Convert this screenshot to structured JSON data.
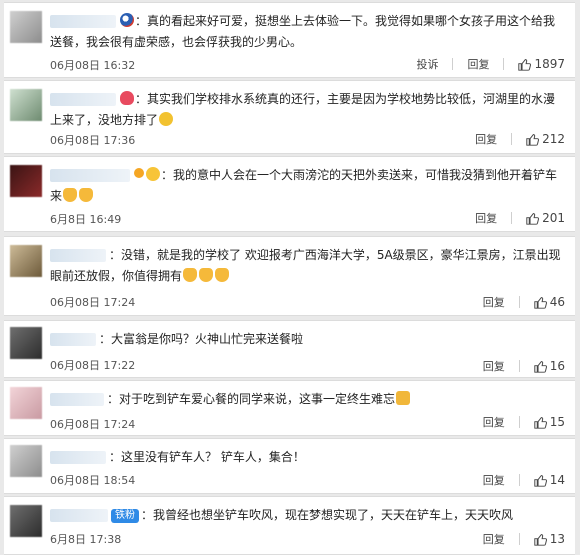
{
  "comments": [
    {
      "text": "真的看起来好可爱，挺想坐上去体验一下。我觉得如果哪个女孩子用这个给我送餐，我会很有虚荣感，也会俘获我的少男心。",
      "date": "06月08日 16:32",
      "report": "投诉",
      "reply": "回复",
      "likes": "1897"
    },
    {
      "text": "其实我们学校排水系统真的还行，主要是因为学校地势比较低，河湖里的水漫上来了，没地方排了",
      "date": "06月08日 17:36",
      "reply": "回复",
      "likes": "212"
    },
    {
      "text": "我的意中人会在一个大雨滂沱的天把外卖送来，可惜我没猜到他开着铲车来",
      "date": "6月8日 16:49",
      "reply": "回复",
      "likes": "201"
    },
    {
      "text": "没错，就是我的学校了 欢迎报考广西海洋大学，5A级景区，豪华江景房，江景出现眼前还放假，你值得拥有",
      "date": "06月08日 17:24",
      "reply": "回复",
      "likes": "46"
    },
    {
      "text": "大富翁是你吗？火神山忙完来送餐啦",
      "date": "06月08日 17:22",
      "reply": "回复",
      "likes": "16"
    },
    {
      "text": "对于吃到铲车爱心餐的同学来说，这事一定终生难忘",
      "date": "06月08日 17:24",
      "reply": "回复",
      "likes": "15"
    },
    {
      "text": "这里没有铲车人？ 铲车人，集合！",
      "date": "06月08日 18:54",
      "reply": "回复",
      "likes": "14"
    },
    {
      "tag": "铁粉",
      "text": "我曾经也想坐铲车吹风，现在梦想实现了，天天在铲车上，天天吹风",
      "date": "6月8日 17:38",
      "reply": "回复",
      "likes": "13"
    }
  ]
}
